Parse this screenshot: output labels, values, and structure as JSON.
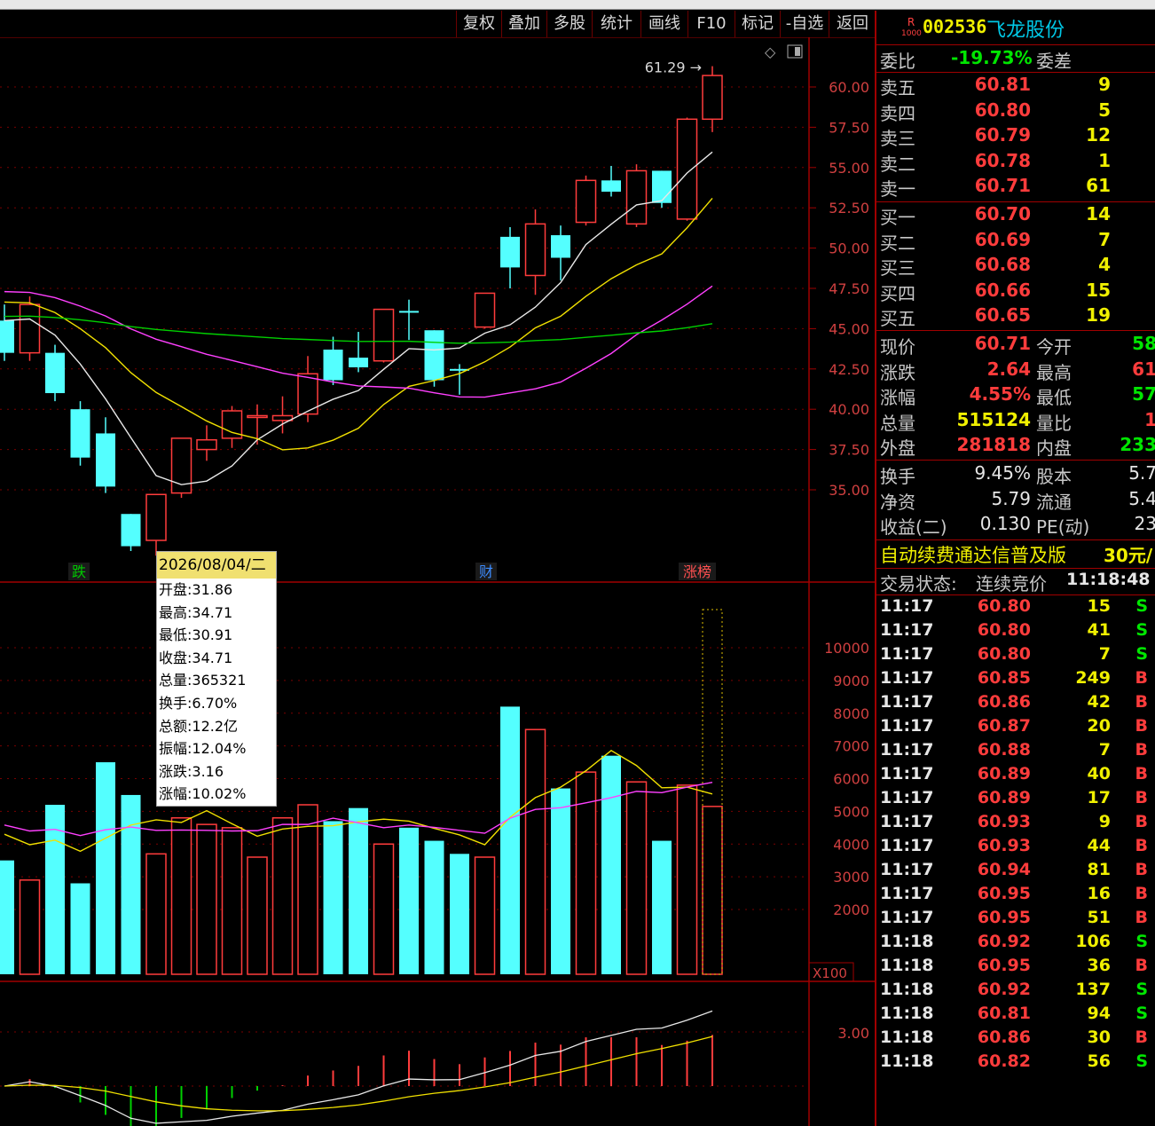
{
  "toolbar": {
    "buttons": [
      "复权",
      "叠加",
      "多股",
      "统计",
      "画线",
      "F10",
      "标记",
      "-自选",
      "返回"
    ]
  },
  "stock": {
    "badge_top": "R",
    "badge_bottom": "1000",
    "code": "002536",
    "name": "飞龙股份"
  },
  "weibi": {
    "label": "委比",
    "value": "-19.73%",
    "diff_label": "委差"
  },
  "sell": [
    {
      "label": "卖五",
      "price": "60.81",
      "vol": "9"
    },
    {
      "label": "卖四",
      "price": "60.80",
      "vol": "5"
    },
    {
      "label": "卖三",
      "price": "60.79",
      "vol": "12"
    },
    {
      "label": "卖二",
      "price": "60.78",
      "vol": "1"
    },
    {
      "label": "卖一",
      "price": "60.71",
      "vol": "61"
    }
  ],
  "buy": [
    {
      "label": "买一",
      "price": "60.70",
      "vol": "14"
    },
    {
      "label": "买二",
      "price": "60.69",
      "vol": "7"
    },
    {
      "label": "买三",
      "price": "60.68",
      "vol": "4"
    },
    {
      "label": "买四",
      "price": "60.66",
      "vol": "15"
    },
    {
      "label": "买五",
      "price": "60.65",
      "vol": "19"
    }
  ],
  "quote": [
    {
      "l1": "现价",
      "v1": "60.71",
      "c1": "red",
      "l2": "今开",
      "v2": "58",
      "c2": "green"
    },
    {
      "l1": "涨跌",
      "v1": "2.64",
      "c1": "red",
      "l2": "最高",
      "v2": "61",
      "c2": "red"
    },
    {
      "l1": "涨幅",
      "v1": "4.55%",
      "c1": "red",
      "l2": "最低",
      "v2": "57",
      "c2": "green"
    },
    {
      "l1": "总量",
      "v1": "515124",
      "c1": "yellow",
      "l2": "量比",
      "v2": "1",
      "c2": "red"
    },
    {
      "l1": "外盘",
      "v1": "281818",
      "c1": "red",
      "l2": "内盘",
      "v2": "233",
      "c2": "green"
    }
  ],
  "fundamentals": [
    {
      "l1": "换手",
      "v1": "9.45%",
      "l2": "股本",
      "v2": "5.7"
    },
    {
      "l1": "净资",
      "v1": "5.79",
      "l2": "流通",
      "v2": "5.4"
    },
    {
      "l1": "收益(二)",
      "v1": "0.130",
      "l2": "PE(动)",
      "v2": "23"
    }
  ],
  "banner": {
    "text": "自动续费通达信普及版",
    "price": "30元/"
  },
  "trade_status": {
    "label": "交易状态:",
    "value": "连续竞价",
    "time": "11:18:48"
  },
  "ticks": [
    {
      "t": "11:17",
      "p": "60.80",
      "v": "15",
      "s": "S"
    },
    {
      "t": "11:17",
      "p": "60.80",
      "v": "41",
      "s": "S"
    },
    {
      "t": "11:17",
      "p": "60.80",
      "v": "7",
      "s": "S"
    },
    {
      "t": "11:17",
      "p": "60.85",
      "v": "249",
      "s": "B"
    },
    {
      "t": "11:17",
      "p": "60.86",
      "v": "42",
      "s": "B"
    },
    {
      "t": "11:17",
      "p": "60.87",
      "v": "20",
      "s": "B"
    },
    {
      "t": "11:17",
      "p": "60.88",
      "v": "7",
      "s": "B"
    },
    {
      "t": "11:17",
      "p": "60.89",
      "v": "40",
      "s": "B"
    },
    {
      "t": "11:17",
      "p": "60.89",
      "v": "17",
      "s": "B"
    },
    {
      "t": "11:17",
      "p": "60.93",
      "v": "9",
      "s": "B"
    },
    {
      "t": "11:17",
      "p": "60.93",
      "v": "44",
      "s": "B"
    },
    {
      "t": "11:17",
      "p": "60.94",
      "v": "81",
      "s": "B"
    },
    {
      "t": "11:17",
      "p": "60.95",
      "v": "16",
      "s": "B"
    },
    {
      "t": "11:17",
      "p": "60.95",
      "v": "51",
      "s": "B"
    },
    {
      "t": "11:18",
      "p": "60.92",
      "v": "106",
      "s": "S"
    },
    {
      "t": "11:18",
      "p": "60.95",
      "v": "36",
      "s": "B"
    },
    {
      "t": "11:18",
      "p": "60.92",
      "v": "137",
      "s": "S"
    },
    {
      "t": "11:18",
      "p": "60.81",
      "v": "94",
      "s": "S"
    },
    {
      "t": "11:18",
      "p": "60.86",
      "v": "30",
      "s": "B"
    },
    {
      "t": "11:18",
      "p": "60.82",
      "v": "56",
      "s": "S"
    }
  ],
  "chart": {
    "price_ticks": [
      "60.00",
      "57.50",
      "55.00",
      "52.50",
      "50.00",
      "47.50",
      "45.00",
      "42.50",
      "40.00",
      "37.50",
      "35.00"
    ],
    "vol_ticks": [
      "10000",
      "9000",
      "8000",
      "7000",
      "6000",
      "5000",
      "4000",
      "3000",
      "2000"
    ],
    "vol_unit": "X100",
    "macd_tick": "3.00",
    "high_label": "61.29",
    "markers": [
      {
        "text": "跌",
        "color": "#00c800"
      },
      {
        "text": "财",
        "color": "#3c8cff"
      },
      {
        "text": "涨榜",
        "color": "#ff5050"
      }
    ]
  },
  "tooltip": {
    "date": "2026/08/04/二",
    "items": [
      "开盘:31.86",
      "最高:34.71",
      "最低:30.91",
      "收盘:34.71",
      "总量:365321",
      "换手:6.70%",
      "总额:12.2亿",
      "振幅:12.04%",
      "涨跌:3.16",
      "涨幅:10.02%"
    ]
  },
  "chart_data": {
    "type": "candlestick",
    "price_axis": [
      35,
      60
    ],
    "candles": [
      {
        "o": 45.5,
        "c": 43.5,
        "h": 46.5,
        "l": 43
      },
      {
        "o": 43.5,
        "c": 46.5,
        "h": 47,
        "l": 43
      },
      {
        "o": 43.5,
        "c": 41,
        "h": 44,
        "l": 40.5
      },
      {
        "o": 40,
        "c": 37,
        "h": 40.5,
        "l": 36.5
      },
      {
        "o": 38.5,
        "c": 35.2,
        "h": 39.5,
        "l": 34.8
      },
      {
        "o": 33.5,
        "c": 31.5,
        "h": 33.5,
        "l": 31.2
      },
      {
        "o": 31.86,
        "c": 34.71,
        "h": 34.71,
        "l": 30.91
      },
      {
        "o": 34.8,
        "c": 38.2,
        "h": 38.2,
        "l": 34.5
      },
      {
        "o": 37.5,
        "c": 38.1,
        "h": 39,
        "l": 36.8
      },
      {
        "o": 38.2,
        "c": 39.9,
        "h": 40.2,
        "l": 37.6
      },
      {
        "o": 39.5,
        "c": 39.6,
        "h": 40.3,
        "l": 37.8
      },
      {
        "o": 39.3,
        "c": 39.6,
        "h": 40.8,
        "l": 38.5
      },
      {
        "o": 39.7,
        "c": 42.2,
        "h": 43.3,
        "l": 39.2
      },
      {
        "o": 43.7,
        "c": 41.8,
        "h": 44.5,
        "l": 41.5
      },
      {
        "o": 43.2,
        "c": 42.6,
        "h": 44.8,
        "l": 42.3
      },
      {
        "o": 43,
        "c": 46.2,
        "h": 46.2,
        "l": 42.9
      },
      {
        "o": 46.1,
        "c": 46.0,
        "h": 46.8,
        "l": 44.3
      },
      {
        "o": 44.9,
        "c": 41.8,
        "h": 44.9,
        "l": 41.4
      },
      {
        "o": 42.5,
        "c": 42.4,
        "h": 42.8,
        "l": 40.9
      },
      {
        "o": 45.1,
        "c": 47.2,
        "h": 47.2,
        "l": 45
      },
      {
        "o": 50.7,
        "c": 48.8,
        "h": 51.3,
        "l": 47.5
      },
      {
        "o": 48.3,
        "c": 51.5,
        "h": 52.4,
        "l": 47.1
      },
      {
        "o": 50.8,
        "c": 49.4,
        "h": 51.4,
        "l": 48
      },
      {
        "o": 51.6,
        "c": 54.2,
        "h": 54.5,
        "l": 51.4
      },
      {
        "o": 54.2,
        "c": 53.5,
        "h": 55.1,
        "l": 53.2
      },
      {
        "o": 51.5,
        "c": 54.8,
        "h": 55.2,
        "l": 51.3
      },
      {
        "o": 54.8,
        "c": 52.8,
        "h": 54.8,
        "l": 52.5
      },
      {
        "o": 51.8,
        "c": 58.0,
        "h": 58.1,
        "l": 51.7
      },
      {
        "o": 58.0,
        "c": 60.71,
        "h": 61.29,
        "l": 57.2
      }
    ],
    "volumes": [
      3500,
      2900,
      5200,
      2800,
      6500,
      5500,
      3700,
      4800,
      4600,
      4500,
      3600,
      4800,
      5200,
      4700,
      5100,
      4000,
      4500,
      4100,
      3700,
      3600,
      8200,
      7500,
      5700,
      6200,
      6700,
      5900,
      4100,
      5800,
      5150
    ],
    "vol_axis": [
      2000,
      10000
    ]
  }
}
